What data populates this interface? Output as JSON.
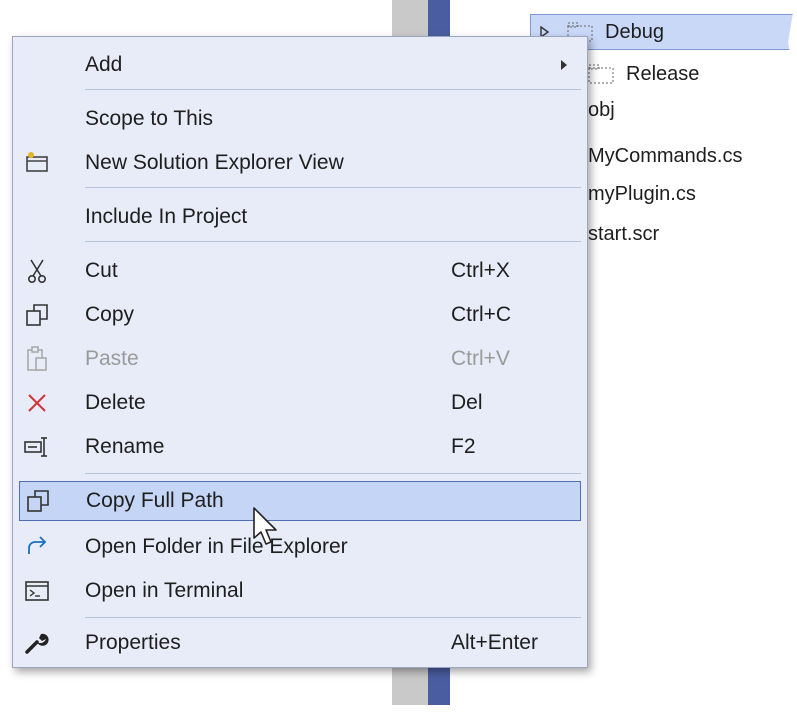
{
  "tree": {
    "items": [
      {
        "label": "Debug",
        "selected": true
      },
      {
        "label": "Release"
      },
      {
        "label": "obj"
      },
      {
        "label": "MyCommands.cs"
      },
      {
        "label": "myPlugin.cs"
      },
      {
        "label": "start.scr"
      }
    ]
  },
  "menu": {
    "items": {
      "add": {
        "label": "Add"
      },
      "scope": {
        "label": "Scope to This"
      },
      "new_view": {
        "label": "New Solution Explorer View"
      },
      "include": {
        "label": "Include In Project"
      },
      "cut": {
        "label": "Cut",
        "shortcut": "Ctrl+X"
      },
      "copy": {
        "label": "Copy",
        "shortcut": "Ctrl+C"
      },
      "paste": {
        "label": "Paste",
        "shortcut": "Ctrl+V",
        "disabled": true
      },
      "delete": {
        "label": "Delete",
        "shortcut": "Del"
      },
      "rename": {
        "label": "Rename",
        "shortcut": "F2"
      },
      "copy_full_path": {
        "label": "Copy Full Path",
        "highlighted": true
      },
      "open_folder": {
        "label": "Open Folder in File Explorer"
      },
      "open_terminal": {
        "label": "Open in Terminal"
      },
      "properties": {
        "label": "Properties",
        "shortcut": "Alt+Enter"
      }
    }
  },
  "icons": {
    "new_view": "new-view-icon",
    "cut": "scissors-icon",
    "copy": "copy-icon",
    "paste": "paste-icon",
    "delete": "delete-x-icon",
    "rename": "rename-icon",
    "copy_full_path": "copy-icon",
    "open_folder": "redirect-arrow-icon",
    "open_terminal": "terminal-icon",
    "properties": "wrench-icon"
  },
  "colors": {
    "menu_bg": "#e8ecf8",
    "highlight_bg": "#c5d5f6",
    "highlight_border": "#4f6db3",
    "delete_red": "#d13438",
    "link_blue": "#1a6fc4"
  }
}
